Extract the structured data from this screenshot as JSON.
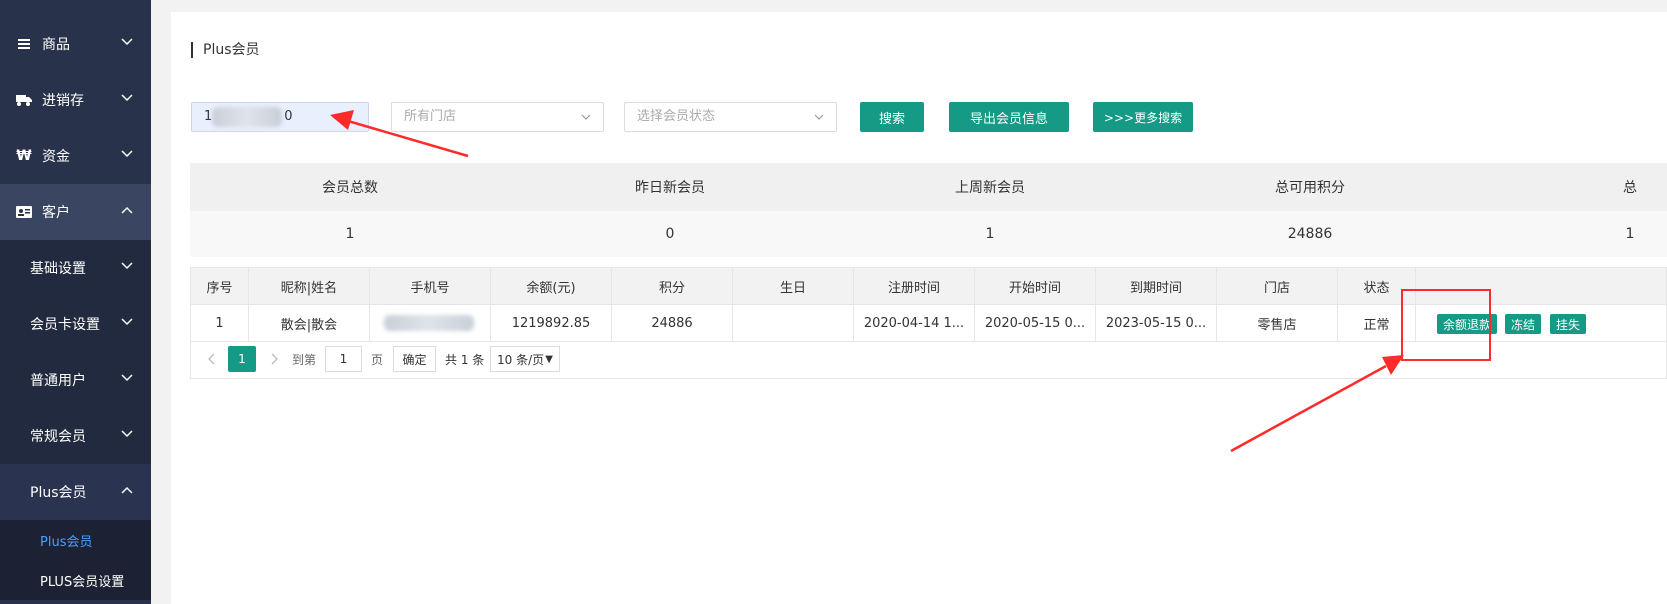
{
  "sidebar": {
    "items": [
      {
        "label": "商品",
        "icon": "list-icon"
      },
      {
        "label": "进销存",
        "icon": "truck-icon"
      },
      {
        "label": "资金",
        "icon": "won-icon"
      },
      {
        "label": "客户",
        "icon": "id-card-icon"
      }
    ],
    "sub_items": [
      {
        "label": "基础设置"
      },
      {
        "label": "会员卡设置"
      },
      {
        "label": "普通用户"
      },
      {
        "label": "常规会员"
      },
      {
        "label": "Plus会员"
      }
    ],
    "leaf_items": [
      {
        "label": "Plus会员"
      },
      {
        "label": "PLUS会员设置"
      }
    ]
  },
  "page": {
    "title": "Plus会员"
  },
  "filters": {
    "search_prefix": "1",
    "search_suffix": "0",
    "store_placeholder": "所有门店",
    "status_placeholder": "选择会员状态",
    "search_button": "搜索",
    "export_button": "导出会员信息",
    "more_search_button": ">>>更多搜索"
  },
  "stats": {
    "headers": [
      "会员总数",
      "昨日新会员",
      "上周新会员",
      "总可用积分",
      "总"
    ],
    "values": [
      "1",
      "0",
      "1",
      "24886",
      "1"
    ]
  },
  "table": {
    "columns": [
      "序号",
      "昵称|姓名",
      "手机号",
      "余额(元)",
      "积分",
      "生日",
      "注册时间",
      "开始时间",
      "到期时间",
      "门店",
      "状态"
    ],
    "rows": [
      {
        "index": "1",
        "name": "散会|散会",
        "phone": "",
        "balance": "1219892.85",
        "points": "24886",
        "birthday": "",
        "registered": "2020-04-14 1...",
        "start": "2020-05-15 0...",
        "end": "2023-05-15 0...",
        "store": "零售店",
        "status": "正常",
        "actions": [
          "余额退款",
          "冻结",
          "挂失"
        ]
      }
    ]
  },
  "pagination": {
    "current": "1",
    "goto_label": "到第",
    "goto_value": "1",
    "page_unit": "页",
    "confirm": "确定",
    "total": "共 1 条",
    "page_size": "10 条/页"
  },
  "colors": {
    "sidebar_bg": "#28324a",
    "accent": "#159a86",
    "annotation": "#ff2a2a"
  }
}
